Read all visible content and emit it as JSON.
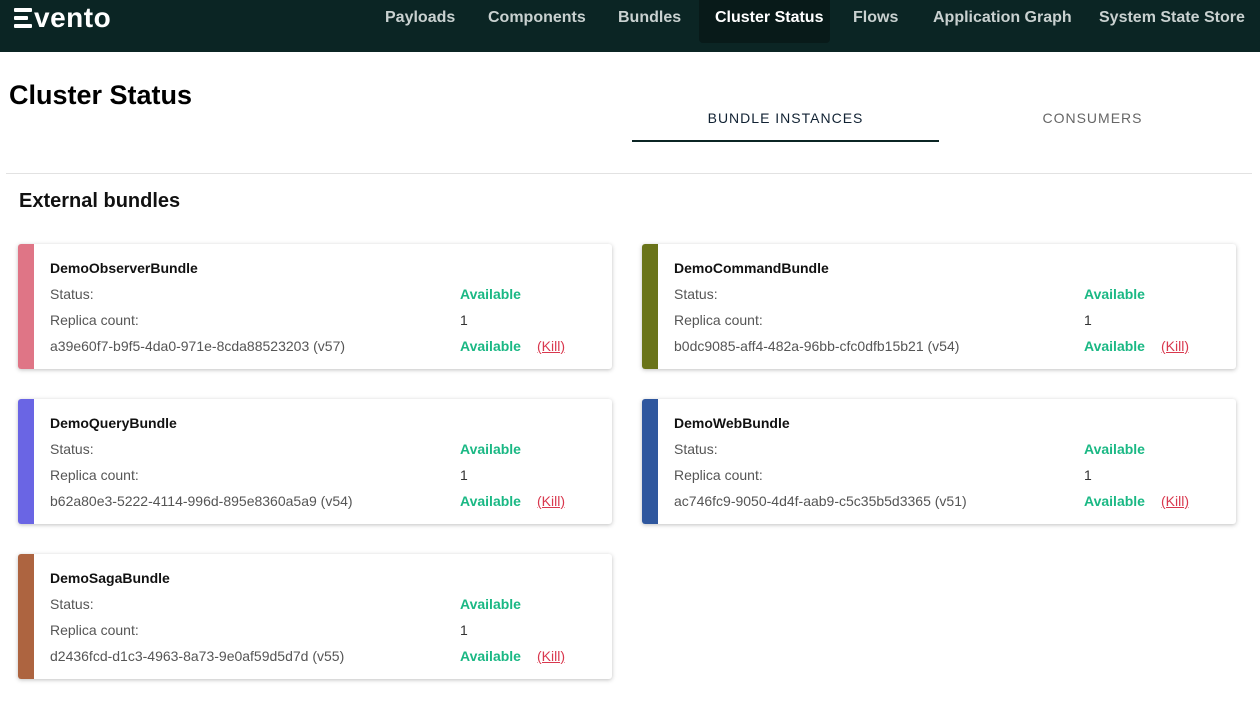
{
  "app": {
    "logo_text": "vento"
  },
  "nav": {
    "items": [
      {
        "label": "Payloads"
      },
      {
        "label": "Components"
      },
      {
        "label": "Bundles"
      },
      {
        "label": "Cluster Status"
      },
      {
        "label": "Flows"
      },
      {
        "label": "Application Graph"
      },
      {
        "label": "System State Store"
      }
    ],
    "active": "Cluster Status"
  },
  "page": {
    "title": "Cluster Status"
  },
  "tabs": [
    {
      "label": "BUNDLE INSTANCES"
    },
    {
      "label": "CONSUMERS"
    }
  ],
  "section": {
    "title": "External bundles"
  },
  "labels": {
    "status": "Status:",
    "replica_count": "Replica count:",
    "kill": "(Kill)"
  },
  "bundles": [
    {
      "name": "DemoObserverBundle",
      "status": "Available",
      "replica_count": "1",
      "instance_id": "a39e60f7-b9f5-4da0-971e-8cda88523203 (v57)",
      "instance_status": "Available",
      "color": "#df7586"
    },
    {
      "name": "DemoCommandBundle",
      "status": "Available",
      "replica_count": "1",
      "instance_id": "b0dc9085-aff4-482a-96bb-cfc0dfb15b21 (v54)",
      "instance_status": "Available",
      "color": "#6a741a"
    },
    {
      "name": "DemoQueryBundle",
      "status": "Available",
      "replica_count": "1",
      "instance_id": "b62a80e3-5222-4114-996d-895e8360a5a9 (v54)",
      "instance_status": "Available",
      "color": "#6a65e4"
    },
    {
      "name": "DemoWebBundle",
      "status": "Available",
      "replica_count": "1",
      "instance_id": "ac746fc9-9050-4d4f-aab9-c5c35b5d3365 (v51)",
      "instance_status": "Available",
      "color": "#2f579e"
    },
    {
      "name": "DemoSagaBundle",
      "status": "Available",
      "replica_count": "1",
      "instance_id": "d2436fcd-d1c3-4963-8a73-9e0af59d5d7d (v55)",
      "instance_status": "Available",
      "color": "#ad6440"
    }
  ]
}
